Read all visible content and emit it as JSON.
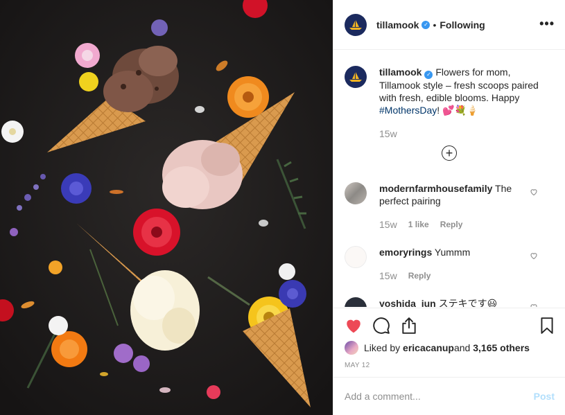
{
  "post": {
    "image_description": "",
    "author": "tillamook",
    "follow_status": "Following",
    "more_label": "•••"
  },
  "caption": {
    "username": "tillamook",
    "text_before_tag": " Flowers for mom, Tillamook style – fresh scoops paired with fresh, edible blooms. Happy ",
    "hashtag": "#MothersDay",
    "text_after_tag": "! 💕💐🍦",
    "time": "15w",
    "load_more_label": "+"
  },
  "comments": [
    {
      "username": "modernfarmhousefamily",
      "text": " The perfect pairing",
      "time": "15w",
      "likes": "1 like",
      "reply": "Reply"
    },
    {
      "username": "emoryrings",
      "text": " Yummm",
      "time": "15w",
      "likes": "",
      "reply": "Reply"
    },
    {
      "username": "yoshida_jun",
      "text": " ステキです😃",
      "time": "",
      "likes": "",
      "reply": ""
    }
  ],
  "engagement": {
    "liked_prefix": "Liked by ",
    "liked_by": "ericacanup",
    "liked_mid": " and ",
    "others": "3,165 others",
    "date": "MAY 12"
  },
  "add_comment": {
    "placeholder": "Add a comment...",
    "post_label": "Post"
  },
  "colors": {
    "like_red": "#ed4956",
    "verified_blue": "#3897f0",
    "hashtag_blue": "#003569",
    "post_button_disabled": "#b2dffc"
  },
  "icons": [
    "heart-icon",
    "comment-icon",
    "share-icon",
    "bookmark-icon",
    "verified-badge-icon",
    "more-options-icon",
    "add-circle-icon"
  ]
}
